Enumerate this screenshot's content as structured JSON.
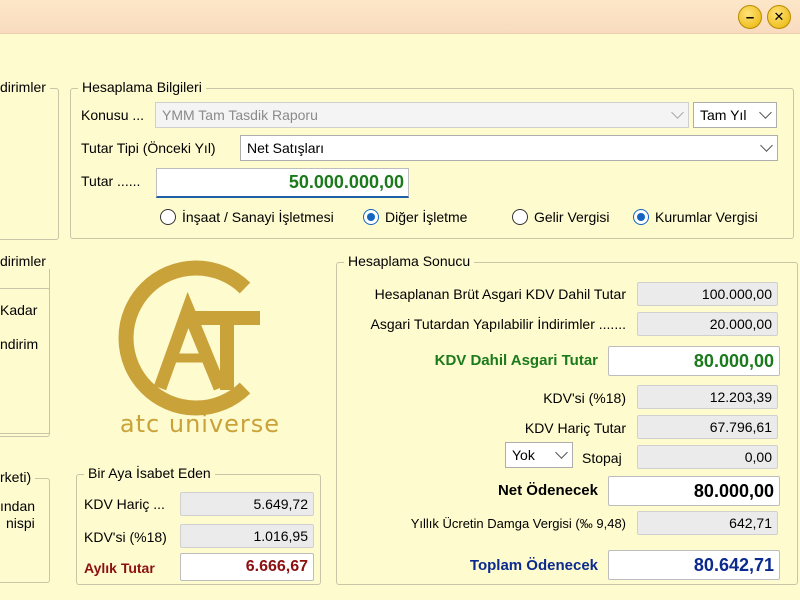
{
  "window": {
    "minimize_glyph": "–",
    "close_glyph": "✕"
  },
  "left_panels": {
    "legend1": "dirimler",
    "legend2": "dirimler",
    "text_kadar": "Kadar",
    "text_indirim": "ndirim",
    "legend3": "rketi)",
    "text_undan": "ından",
    "text_nispi": "nispi"
  },
  "hesaplama_bilgileri": {
    "legend": "Hesaplama Bilgileri",
    "konusu_label": "Konusu ...",
    "konusu_value": "YMM Tam Tasdik Raporu",
    "period_value": "Tam Yıl",
    "tutar_tipi_label": "Tutar Tipi (Önceki Yıl)",
    "tutar_tipi_value": "Net Satışları",
    "tutar_label": "Tutar ......",
    "tutar_value": "50.000.000,00",
    "radio_insaat": "İnşaat / Sanayi İşletmesi",
    "radio_diger": "Diğer İşletme",
    "radio_gelir": "Gelir Vergisi",
    "radio_kurumlar": "Kurumlar Vergisi"
  },
  "logo": {
    "text": "atc universe",
    "brand_color": "#c9a23a"
  },
  "bir_aya": {
    "legend": "Bir Aya İsabet Eden",
    "kdv_haric_label": "KDV Hariç ...",
    "kdv_haric_value": "5.649,72",
    "kdvsi_label": "KDV'si (%18)",
    "kdvsi_value": "1.016,95",
    "aylik_label": "Aylık Tutar",
    "aylik_value": "6.666,67"
  },
  "hesaplama_sonucu": {
    "legend": "Hesaplama Sonucu",
    "brut_label": "Hesaplanan Brüt Asgari KDV Dahil Tutar",
    "brut_value": "100.000,00",
    "indirim_label": "Asgari Tutardan Yapılabilir İndirimler .......",
    "indirim_value": "20.000,00",
    "kdv_dahil_label": "KDV Dahil Asgari Tutar",
    "kdv_dahil_value": "80.000,00",
    "kdvsi_label": "KDV'si (%18)",
    "kdvsi_value": "12.203,39",
    "kdv_haric_label": "KDV Hariç Tutar",
    "kdv_haric_value": "67.796,61",
    "stopaj_select": "Yok",
    "stopaj_label": "Stopaj",
    "stopaj_value": "0,00",
    "net_label": "Net Ödenecek",
    "net_value": "80.000,00",
    "damga_label": "Yıllık Ücretin Damga Vergisi (‰ 9,48)",
    "damga_value": "642,71",
    "toplam_label": "Toplam Ödenecek",
    "toplam_value": "80.642,71"
  },
  "colors": {
    "green": "#1b7a1b",
    "dark_red": "#8b1010",
    "navy": "#0b2a8f",
    "radio_blue": "#1565c0",
    "background": "#fefbcf"
  }
}
